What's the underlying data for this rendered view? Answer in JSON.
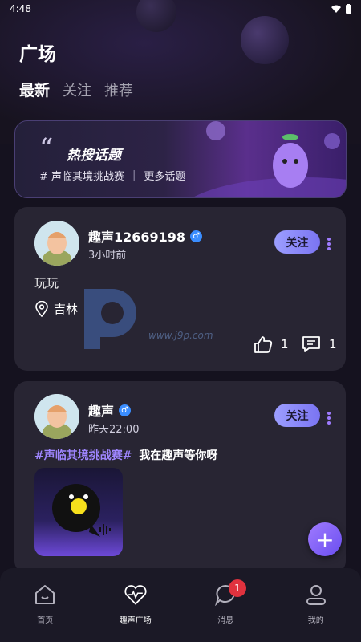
{
  "status_bar": {
    "time": "4:48"
  },
  "page": {
    "title": "广场"
  },
  "tabs": [
    {
      "label": "最新",
      "active": true
    },
    {
      "label": "关注",
      "active": false
    },
    {
      "label": "推荐",
      "active": false
    }
  ],
  "banner": {
    "title": "热搜话题",
    "topic": "# 声临其境挑战赛",
    "more_label": "更多话题"
  },
  "posts": [
    {
      "username": "趣声12669198",
      "gender_icon": "male-icon",
      "time": "3小时前",
      "follow_label": "关注",
      "text": "玩玩",
      "location": "吉林",
      "likes": "1",
      "comments": "1"
    },
    {
      "username": "趣声",
      "gender_icon": "male-icon",
      "time": "昨天22:00",
      "follow_label": "关注",
      "hashtag": "#声临其境挑战赛#",
      "text": "我在趣声等你呀"
    }
  ],
  "watermark": {
    "url": "www.j9p.com"
  },
  "nav": {
    "items": [
      {
        "label": "首页",
        "icon": "home-icon"
      },
      {
        "label": "趣声广场",
        "icon": "plaza-heart-icon",
        "active": true
      },
      {
        "label": "消息",
        "icon": "message-icon",
        "badge": "1"
      },
      {
        "label": "我的",
        "icon": "profile-icon"
      }
    ]
  },
  "colors": {
    "accent": "#8b82f8",
    "badge": "#e0323e",
    "hashtag": "#9f86ff",
    "male": "#3a8dff"
  }
}
